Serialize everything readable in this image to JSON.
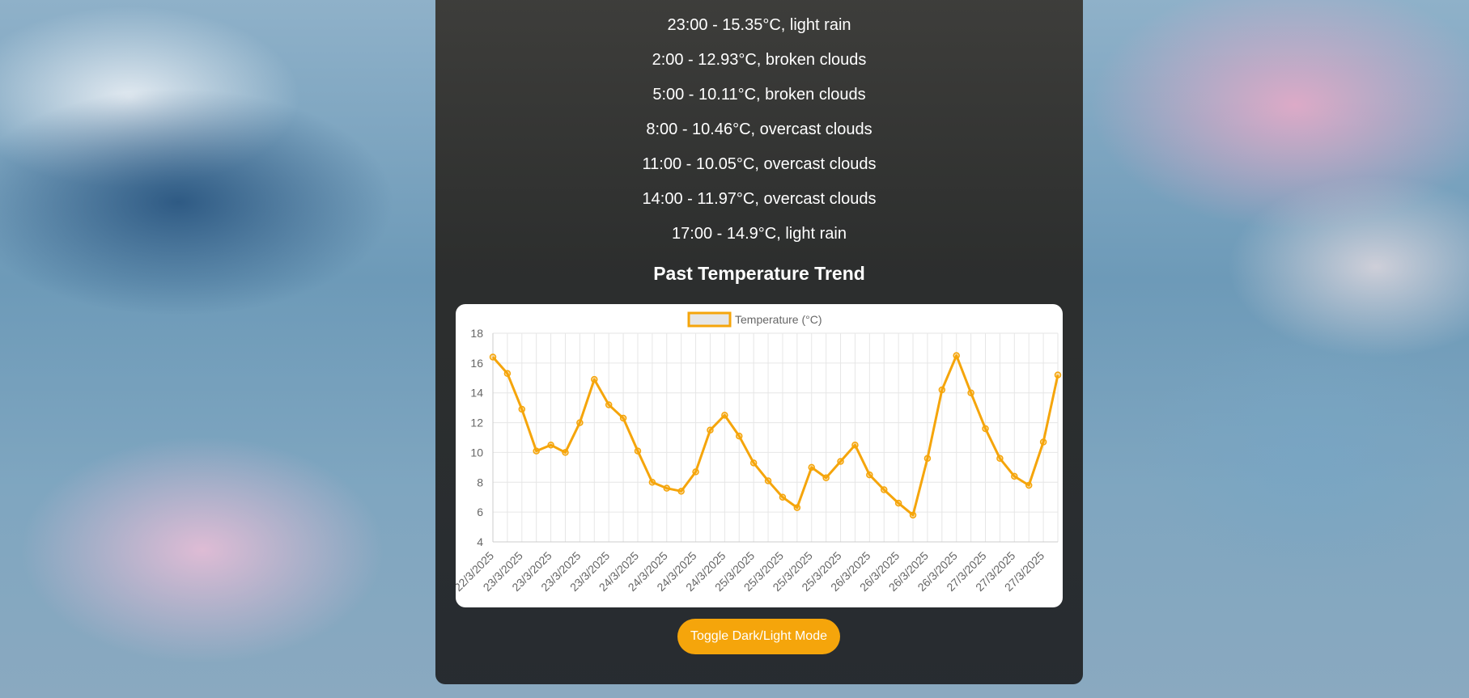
{
  "forecast": [
    "23:00 - 15.35°C, light rain",
    "2:00 - 12.93°C, broken clouds",
    "5:00 - 10.11°C, broken clouds",
    "8:00 - 10.46°C, overcast clouds",
    "11:00 - 10.05°C, overcast clouds",
    "14:00 - 11.97°C, overcast clouds",
    "17:00 - 14.9°C, light rain"
  ],
  "chart_heading": "Past Temperature Trend",
  "toggle_label": "Toggle Dark/Light Mode",
  "colors": {
    "accent": "#f5a50b",
    "line": "#f5a50b",
    "grid": "#e6e6e6",
    "legend_fill": "#e6e6e6"
  },
  "chart_data": {
    "type": "line",
    "legend": "Temperature (°C)",
    "legend_position": "top",
    "grid": true,
    "ylim": [
      4,
      18
    ],
    "y_ticks": [
      4,
      6,
      8,
      10,
      12,
      14,
      16,
      18
    ],
    "x_tick_labels": [
      "22/3/2025",
      "23/3/2025",
      "23/3/2025",
      "23/3/2025",
      "23/3/2025",
      "24/3/2025",
      "24/3/2025",
      "24/3/2025",
      "24/3/2025",
      "25/3/2025",
      "25/3/2025",
      "25/3/2025",
      "25/3/2025",
      "26/3/2025",
      "26/3/2025",
      "26/3/2025",
      "26/3/2025",
      "27/3/2025",
      "27/3/2025",
      "27/3/2025"
    ],
    "series": [
      {
        "name": "Temperature (°C)",
        "values": [
          16.4,
          15.3,
          12.9,
          10.1,
          10.5,
          10.0,
          12.0,
          14.9,
          13.2,
          12.3,
          10.1,
          8.0,
          7.6,
          7.4,
          8.7,
          11.5,
          12.5,
          11.1,
          9.3,
          8.1,
          7.0,
          6.3,
          9.0,
          8.3,
          9.4,
          10.5,
          8.5,
          7.5,
          6.6,
          5.8,
          9.6,
          14.2,
          16.5,
          14.0,
          11.6,
          9.6,
          8.4,
          7.8,
          10.7,
          15.2
        ]
      }
    ]
  }
}
